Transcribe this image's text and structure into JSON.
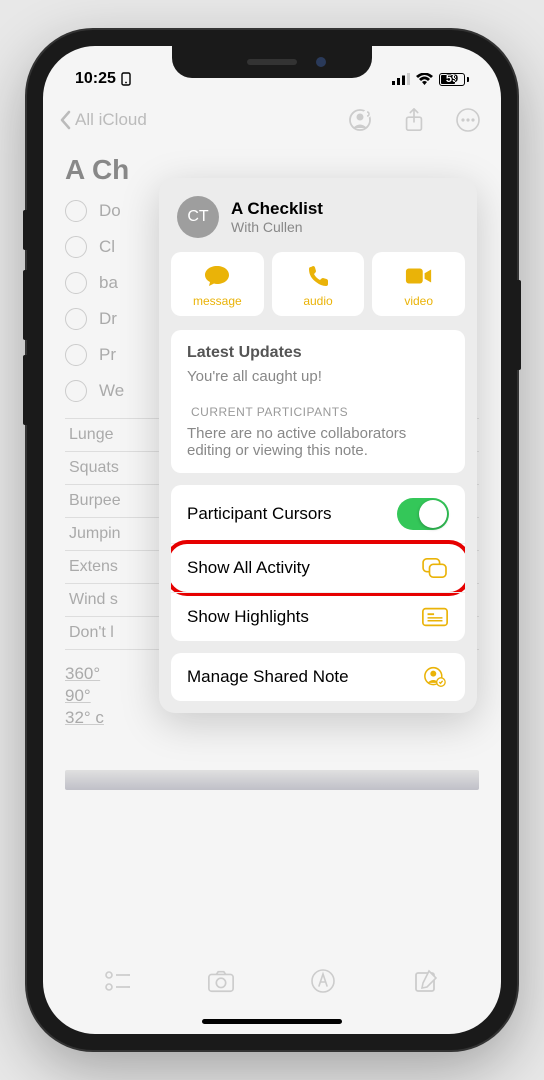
{
  "status": {
    "time": "10:25",
    "battery": "59"
  },
  "nav": {
    "back": "All iCloud"
  },
  "note": {
    "title": "A Ch",
    "checklist": [
      "Do",
      "Cl",
      "ba",
      "Dr",
      "Pr",
      "We"
    ],
    "table": [
      "Lunge",
      "Squats",
      "Burpee",
      "Jumpin",
      "Extens",
      "Wind s",
      "Don't l"
    ],
    "degrees": [
      "360°",
      "90°",
      "32° c"
    ]
  },
  "popover": {
    "avatar": "CT",
    "title": "A Checklist",
    "subtitle": "With Cullen",
    "contacts": {
      "message": "message",
      "audio": "audio",
      "video": "video"
    },
    "updates_heading": "Latest Updates",
    "updates_text": "You're all caught up!",
    "participants_label": "CURRENT PARTICIPANTS",
    "participants_text": "There are no active collaborators editing or viewing this note.",
    "rows": {
      "cursors": "Participant Cursors",
      "activity": "Show All Activity",
      "highlights": "Show Highlights",
      "manage": "Manage Shared Note"
    }
  }
}
